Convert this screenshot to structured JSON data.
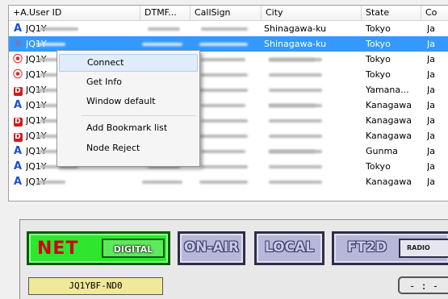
{
  "columns": [
    "+A.User ID",
    "DTMF...",
    "CallSign",
    "City",
    "State",
    "Co"
  ],
  "rows": [
    {
      "icon": "A",
      "id": "JQ1Y",
      "city": "Shinagawa-ku",
      "state": "Tokyo",
      "co": "Ja"
    },
    {
      "icon": "X",
      "id": "JQ1Y",
      "city": "Shinagawa-ku",
      "state": "Tokyo",
      "co": "Ja",
      "selected": true
    },
    {
      "icon": "W",
      "id": "JQ1Y",
      "city": "",
      "state": "Tokyo",
      "co": "Ja"
    },
    {
      "icon": "W",
      "id": "JQ1Y",
      "city": "",
      "state": "Tokyo",
      "co": "Ja"
    },
    {
      "icon": "D",
      "id": "JQ1Y",
      "city": "",
      "state": "Yamana...",
      "co": "Ja"
    },
    {
      "icon": "A",
      "id": "JQ1Y",
      "city": "",
      "state": "Kanagawa",
      "co": "Ja"
    },
    {
      "icon": "D",
      "id": "JQ1Y",
      "city": "",
      "state": "Kanagawa",
      "co": "Ja"
    },
    {
      "icon": "D",
      "id": "JQ1Y",
      "city": "",
      "state": "Kanagawa",
      "co": "Ja"
    },
    {
      "icon": "A",
      "id": "JQ1Y",
      "city": "",
      "state": "Gunma",
      "co": "Ja"
    },
    {
      "icon": "A",
      "id": "JQ1Y",
      "city": "",
      "state": "Tokyo",
      "co": "Ja"
    },
    {
      "icon": "A",
      "id": "JQ1Y",
      "city": "",
      "state": "Kanagawa",
      "co": "Ja"
    }
  ],
  "context_menu": {
    "items": [
      "Connect",
      "Get Info",
      "Window default",
      "Add Bookmark list",
      "Node Reject"
    ],
    "highlighted": "Connect"
  },
  "panel": {
    "net": "NET",
    "digital": "DIGITAL",
    "on_air": "ON-AIR",
    "local": "LOCAL",
    "ft2d": "FT2D",
    "radio": "RADIO",
    "node": "JQ1YBF-ND0",
    "clock": "- : -"
  },
  "colors": {
    "selection": "#3399ff",
    "net_green": "#2ee62e",
    "net_text": "#d1001a",
    "node_bg": "#f0e89a",
    "dim_button": "#b7b7d9"
  },
  "icons": {
    "A": "asterisk-a-icon",
    "D": "dstar-d-icon",
    "W": "wifi-icon",
    "X": "node-x-icon"
  }
}
